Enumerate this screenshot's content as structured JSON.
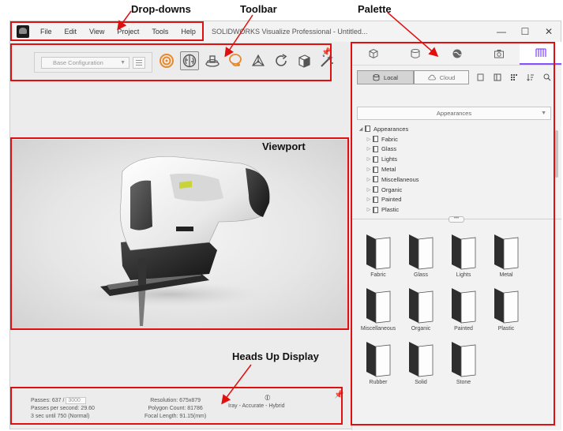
{
  "annotations": {
    "dropdowns": "Drop-downs",
    "toolbar": "Toolbar",
    "palette": "Palette",
    "viewport": "Viewport",
    "hud": "Heads Up Display"
  },
  "window": {
    "title": "SOLIDWORKS Visualize Professional - Untitled...",
    "menu": [
      "File",
      "Edit",
      "View",
      "Project",
      "Tools",
      "Help"
    ],
    "controls": {
      "minimize": "—",
      "maximize": "☐",
      "close": "✕"
    }
  },
  "toolbar": {
    "configuration": "Base Configuration",
    "tools": [
      "target-icon",
      "brain-icon",
      "turntable-icon",
      "lightbulb-icon",
      "axes-icon",
      "refresh-icon",
      "cube-icon",
      "magic-wand-icon"
    ]
  },
  "palette": {
    "tabs": [
      "models-tab",
      "cameras-tab",
      "scenes-tab",
      "camera-tab",
      "library-tab"
    ],
    "local_label": "Local",
    "cloud_label": "Cloud",
    "dropdown_value": "Appearances",
    "tree_root": "Appearances",
    "tree_items": [
      "Fabric",
      "Glass",
      "Lights",
      "Metal",
      "Miscellaneous",
      "Organic",
      "Painted",
      "Plastic"
    ],
    "tiles": [
      "Fabric",
      "Glass",
      "Lights",
      "Metal",
      "Miscellaneous",
      "Organic",
      "Painted",
      "Plastic",
      "Rubber",
      "Solid",
      "Stone"
    ],
    "splitter_grip": "•••"
  },
  "hud": {
    "passes_label": "Passes: 637 /",
    "passes_target": "3000",
    "passes_per_second": "Passes per second: 29.60",
    "time_until": "3 sec until 750 (Normal)",
    "resolution": "Resolution: 675x879",
    "polygon_count": "Polygon Count: 81786",
    "focal_length": "Focal Length: 91.15(mm)",
    "render_mode": "Iray - Accurate - Hybrid"
  },
  "colors": {
    "annotation_red": "#e01010",
    "accent_purple": "#8a4fff",
    "accent_orange": "#e8892a",
    "chartreuse": "#c9d43a"
  }
}
